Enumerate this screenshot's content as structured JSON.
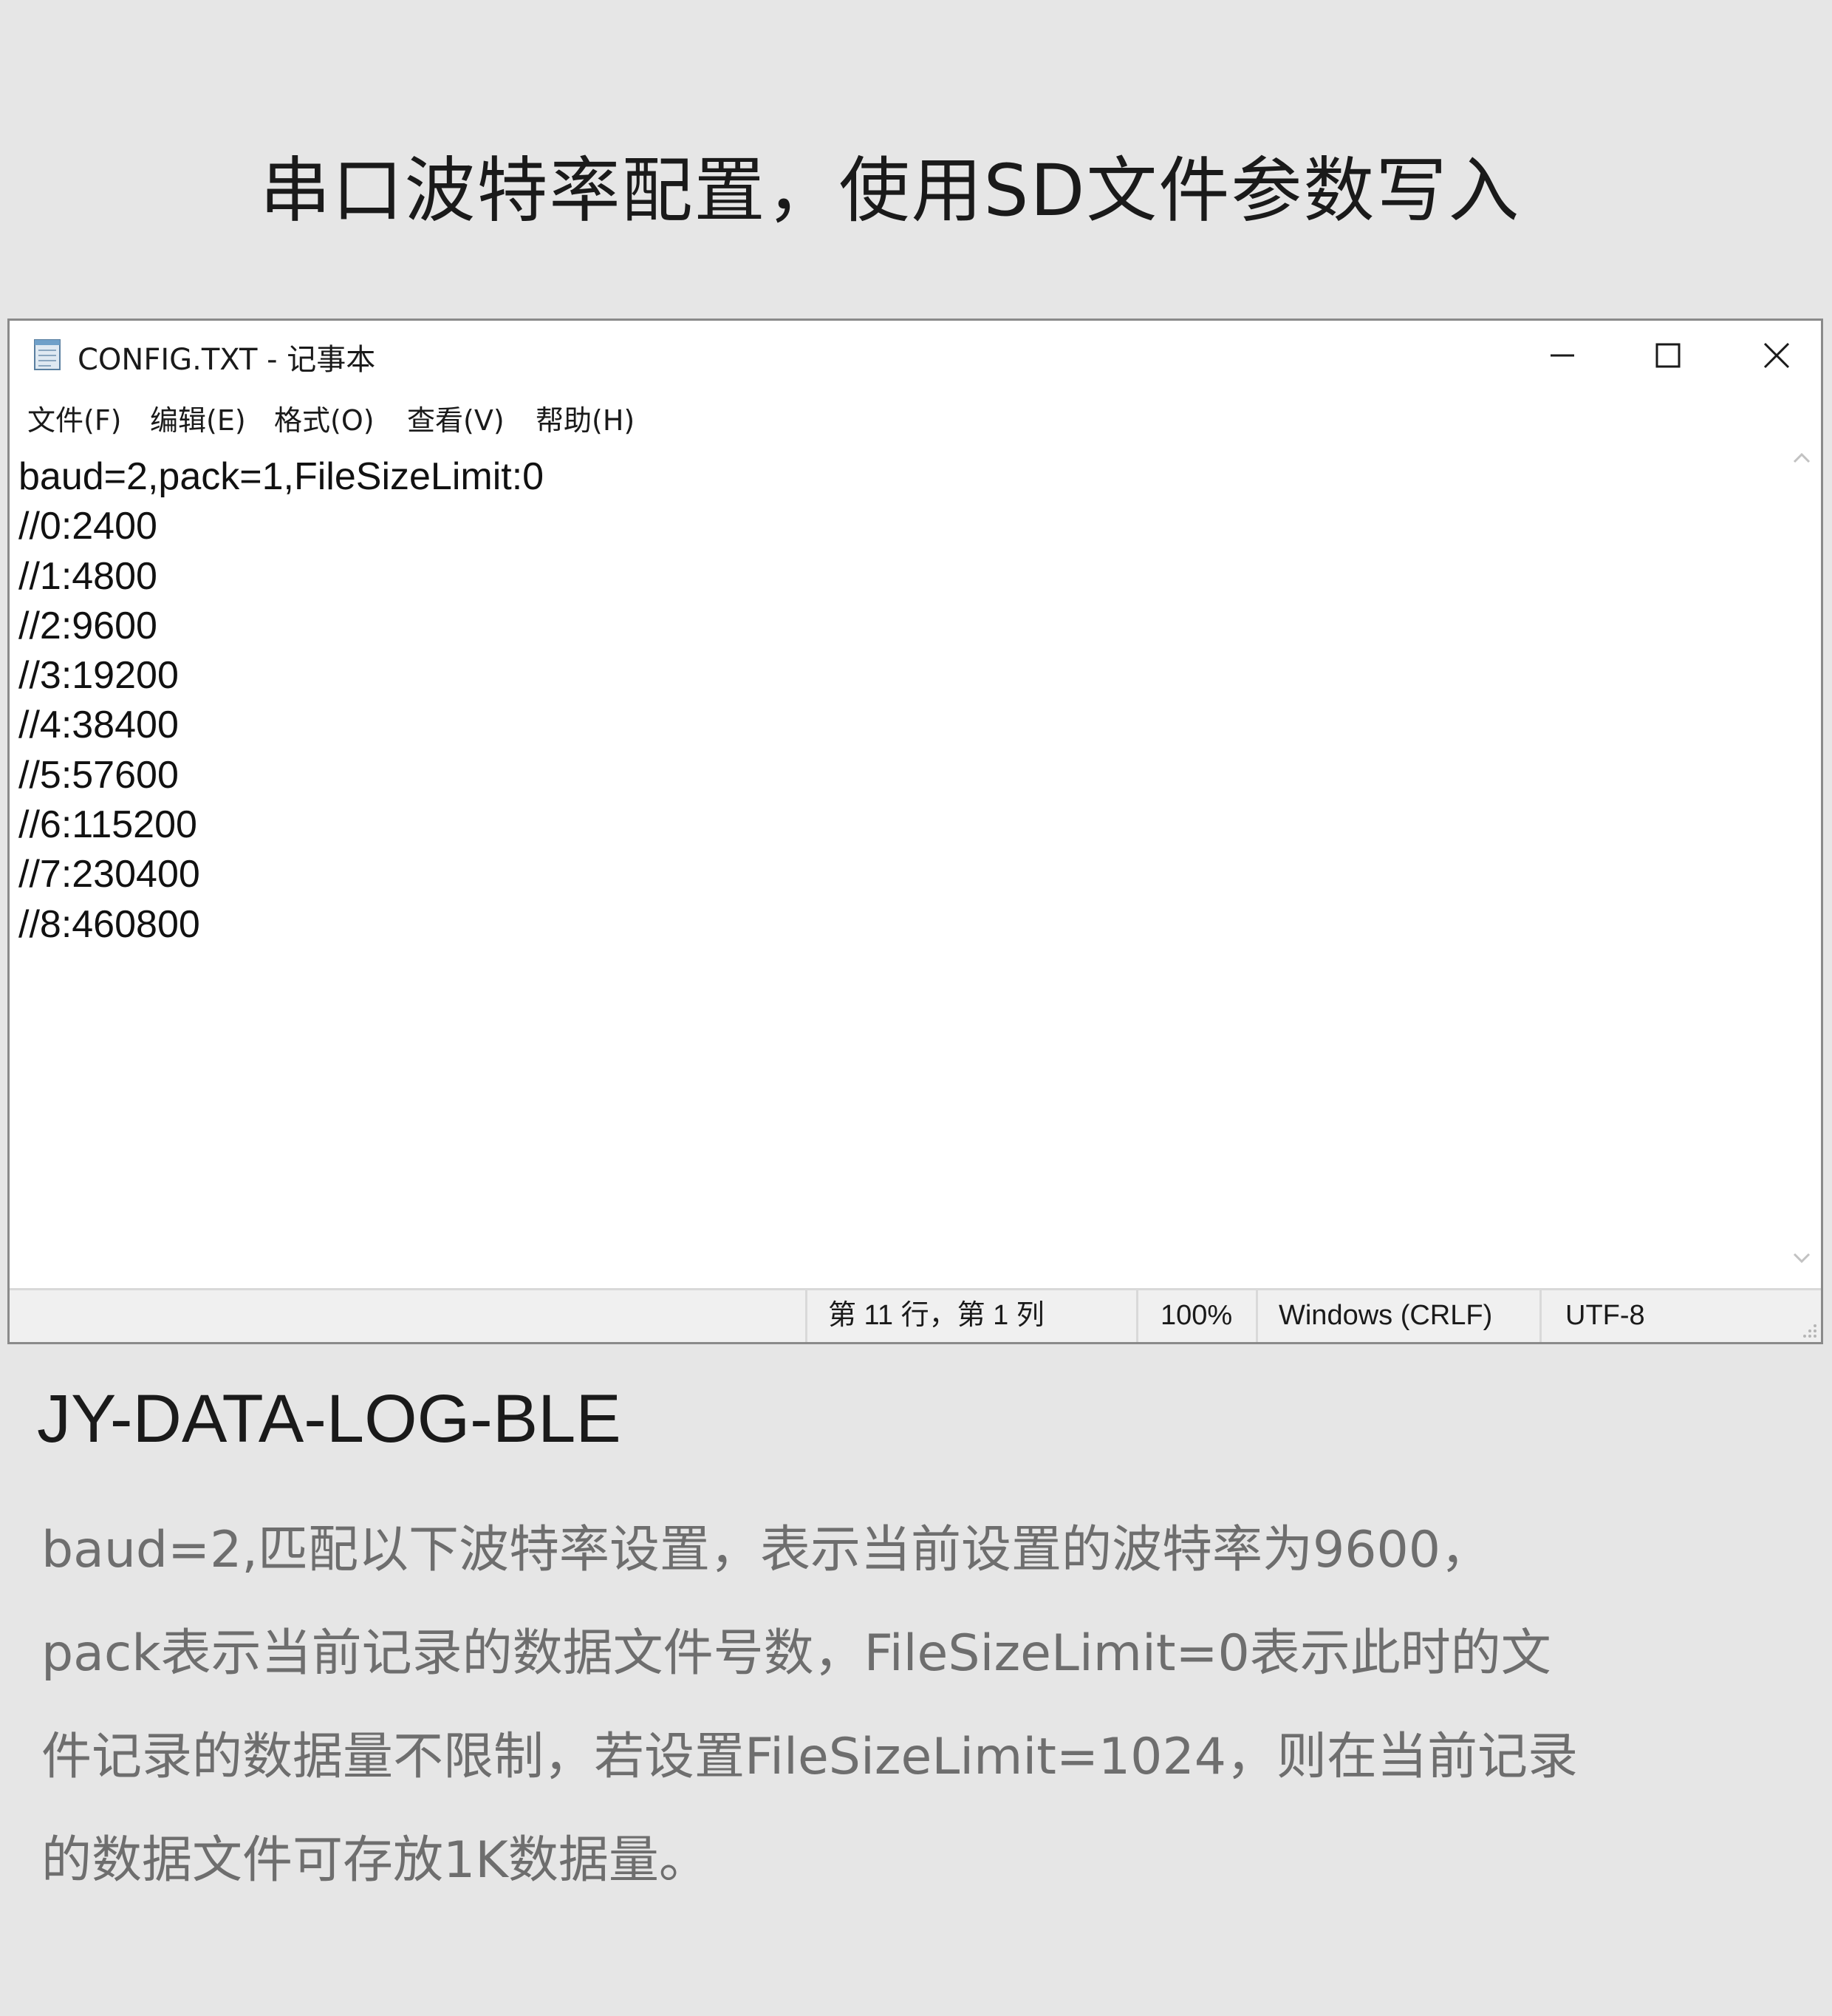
{
  "page_title": "串口波特率配置，使用SD文件参数写入",
  "window": {
    "app_icon": "notepad-icon",
    "title": "CONFIG.TXT - 记事本",
    "controls": {
      "minimize_icon": "minimize-icon",
      "maximize_icon": "maximize-icon",
      "close_icon": "close-icon"
    }
  },
  "menu": {
    "items": [
      {
        "label": "文件(F)"
      },
      {
        "label": "编辑(E)"
      },
      {
        "label": "格式(O)"
      },
      {
        "label": "查看(V)"
      },
      {
        "label": "帮助(H)"
      }
    ]
  },
  "editor": {
    "content": "baud=2,pack=1,FileSizeLimit:0\n//0:2400\n//1:4800\n//2:9600\n//3:19200\n//4:38400\n//5:57600\n//6:115200\n//7:230400\n//8:460800"
  },
  "statusbar": {
    "position": "第 11 行，第 1 列",
    "zoom": "100%",
    "line_ending": "Windows (CRLF)",
    "encoding": "UTF-8"
  },
  "product_name": "JY-DATA-LOG-BLE",
  "description": {
    "lines": [
      "baud=2,匹配以下波特率设置，表示当前设置的波特率为9600，",
      "pack表示当前记录的数据文件号数，FileSizeLimit=0表示此时的文",
      "件记录的数据量不限制，若设置FileSizeLimit=1024，则在当前记录",
      "的数据文件可存放1K数据量。"
    ]
  }
}
